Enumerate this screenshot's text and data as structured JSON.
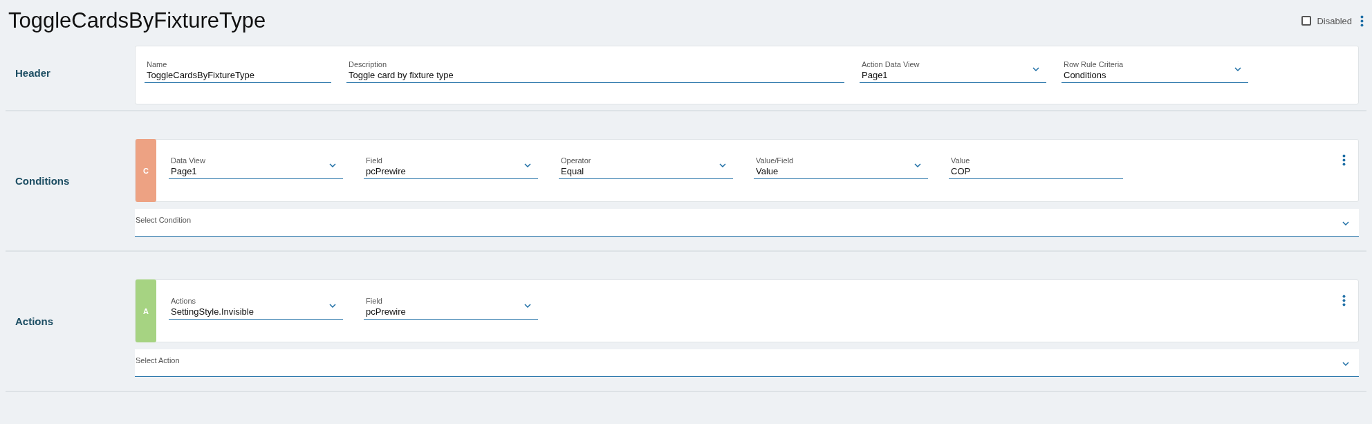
{
  "title": "ToggleCardsByFixtureType",
  "disabled_toggle": {
    "label": "Disabled",
    "checked": false
  },
  "sections": [
    {
      "kind": "fields",
      "label": "Header",
      "fields": [
        {
          "kind": "text",
          "label": "Name",
          "value": "ToggleCardsByFixtureType"
        },
        {
          "kind": "text",
          "label": "Description",
          "value": "Toggle card by fixture type"
        },
        {
          "kind": "dropdown",
          "label": "Action Data View",
          "value": "Page1"
        },
        {
          "kind": "dropdown",
          "label": "Row Rule Criteria",
          "value": "Conditions"
        }
      ]
    },
    {
      "kind": "rules",
      "label": "Conditions",
      "rules": [
        {
          "badge": "C",
          "color": "#eda283",
          "fields": [
            {
              "kind": "dropdown",
              "label": "Data View",
              "value": "Page1"
            },
            {
              "kind": "dropdown",
              "label": "Field",
              "value": "pcPrewire"
            },
            {
              "kind": "dropdown",
              "label": "Operator",
              "value": "Equal"
            },
            {
              "kind": "dropdown",
              "label": "Value/Field",
              "value": "Value"
            },
            {
              "kind": "text",
              "label": "Value",
              "value": "COP"
            }
          ]
        }
      ],
      "select": {
        "label": "Select Condition"
      }
    },
    {
      "kind": "rules",
      "label": "Actions",
      "rules": [
        {
          "badge": "A",
          "color": "#a6d382",
          "fields": [
            {
              "kind": "dropdown",
              "label": "Actions",
              "value": "SettingStyle.Invisible"
            },
            {
              "kind": "dropdown",
              "label": "Field",
              "value": "pcPrewire"
            }
          ]
        }
      ],
      "select": {
        "label": "Select Action"
      }
    }
  ]
}
